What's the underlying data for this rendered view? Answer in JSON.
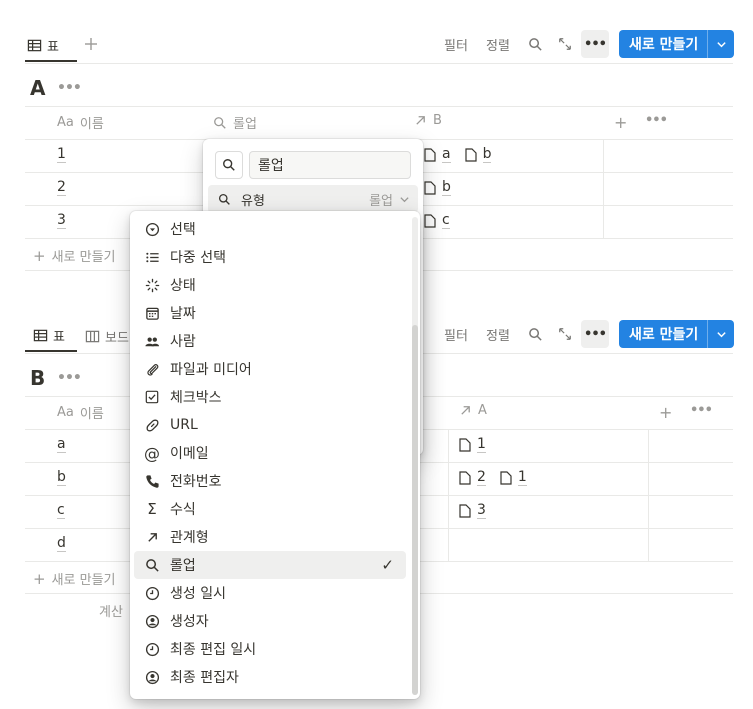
{
  "view_bar_1": {
    "tab_table": "표",
    "filter": "필터",
    "sort": "정렬",
    "new": "새로 만들기"
  },
  "db_a": {
    "title": "A",
    "columns": {
      "name": "이름",
      "rollup": "롤업",
      "relation": "B",
      "name_type": "Aa"
    },
    "rows": [
      {
        "name": "1",
        "rel": [
          "a",
          "b"
        ]
      },
      {
        "name": "2",
        "rel": [
          "b"
        ]
      },
      {
        "name": "3",
        "rel": [
          "c"
        ]
      }
    ],
    "new_row": "새로 만들기"
  },
  "view_bar_2": {
    "tab_table": "표",
    "tab_board": "보드",
    "filter": "필터",
    "sort": "정렬",
    "new": "새로 만들기"
  },
  "db_b": {
    "title": "B",
    "columns": {
      "name": "이름",
      "relation": "A",
      "name_type": "Aa"
    },
    "rows": [
      {
        "name": "a",
        "rel": [
          "1"
        ]
      },
      {
        "name": "b",
        "rel": [
          "2",
          "1"
        ]
      },
      {
        "name": "c",
        "rel": [
          "3"
        ]
      },
      {
        "name": "d",
        "rel": []
      }
    ],
    "new_row": "새로 만들기",
    "calculate": "계산"
  },
  "property_popup": {
    "name_value": "롤업",
    "type_label": "유형",
    "type_value": "롤업"
  },
  "type_menu": {
    "items": [
      {
        "label": "선택",
        "icon": "select-icon"
      },
      {
        "label": "다중 선택",
        "icon": "multi-select-icon"
      },
      {
        "label": "상태",
        "icon": "status-icon"
      },
      {
        "label": "날짜",
        "icon": "calendar-icon"
      },
      {
        "label": "사람",
        "icon": "people-icon"
      },
      {
        "label": "파일과 미디어",
        "icon": "paperclip-icon"
      },
      {
        "label": "체크박스",
        "icon": "checkbox-icon"
      },
      {
        "label": "URL",
        "icon": "link-icon"
      },
      {
        "label": "이메일",
        "icon": "at-icon"
      },
      {
        "label": "전화번호",
        "icon": "phone-icon"
      },
      {
        "label": "수식",
        "icon": "sigma-icon"
      },
      {
        "label": "관계형",
        "icon": "arrow-up-right-icon"
      },
      {
        "label": "롤업",
        "icon": "search-icon",
        "selected": true
      },
      {
        "label": "생성 일시",
        "icon": "clock-icon"
      },
      {
        "label": "생성자",
        "icon": "person-circle-icon"
      },
      {
        "label": "최종 편집 일시",
        "icon": "clock-icon"
      },
      {
        "label": "최종 편집자",
        "icon": "person-circle-icon"
      }
    ],
    "check": "✓"
  },
  "colors": {
    "accent": "#2383e2",
    "text": "#37352f",
    "muted": "#9b9a97",
    "selected_bg": "#efefee"
  }
}
